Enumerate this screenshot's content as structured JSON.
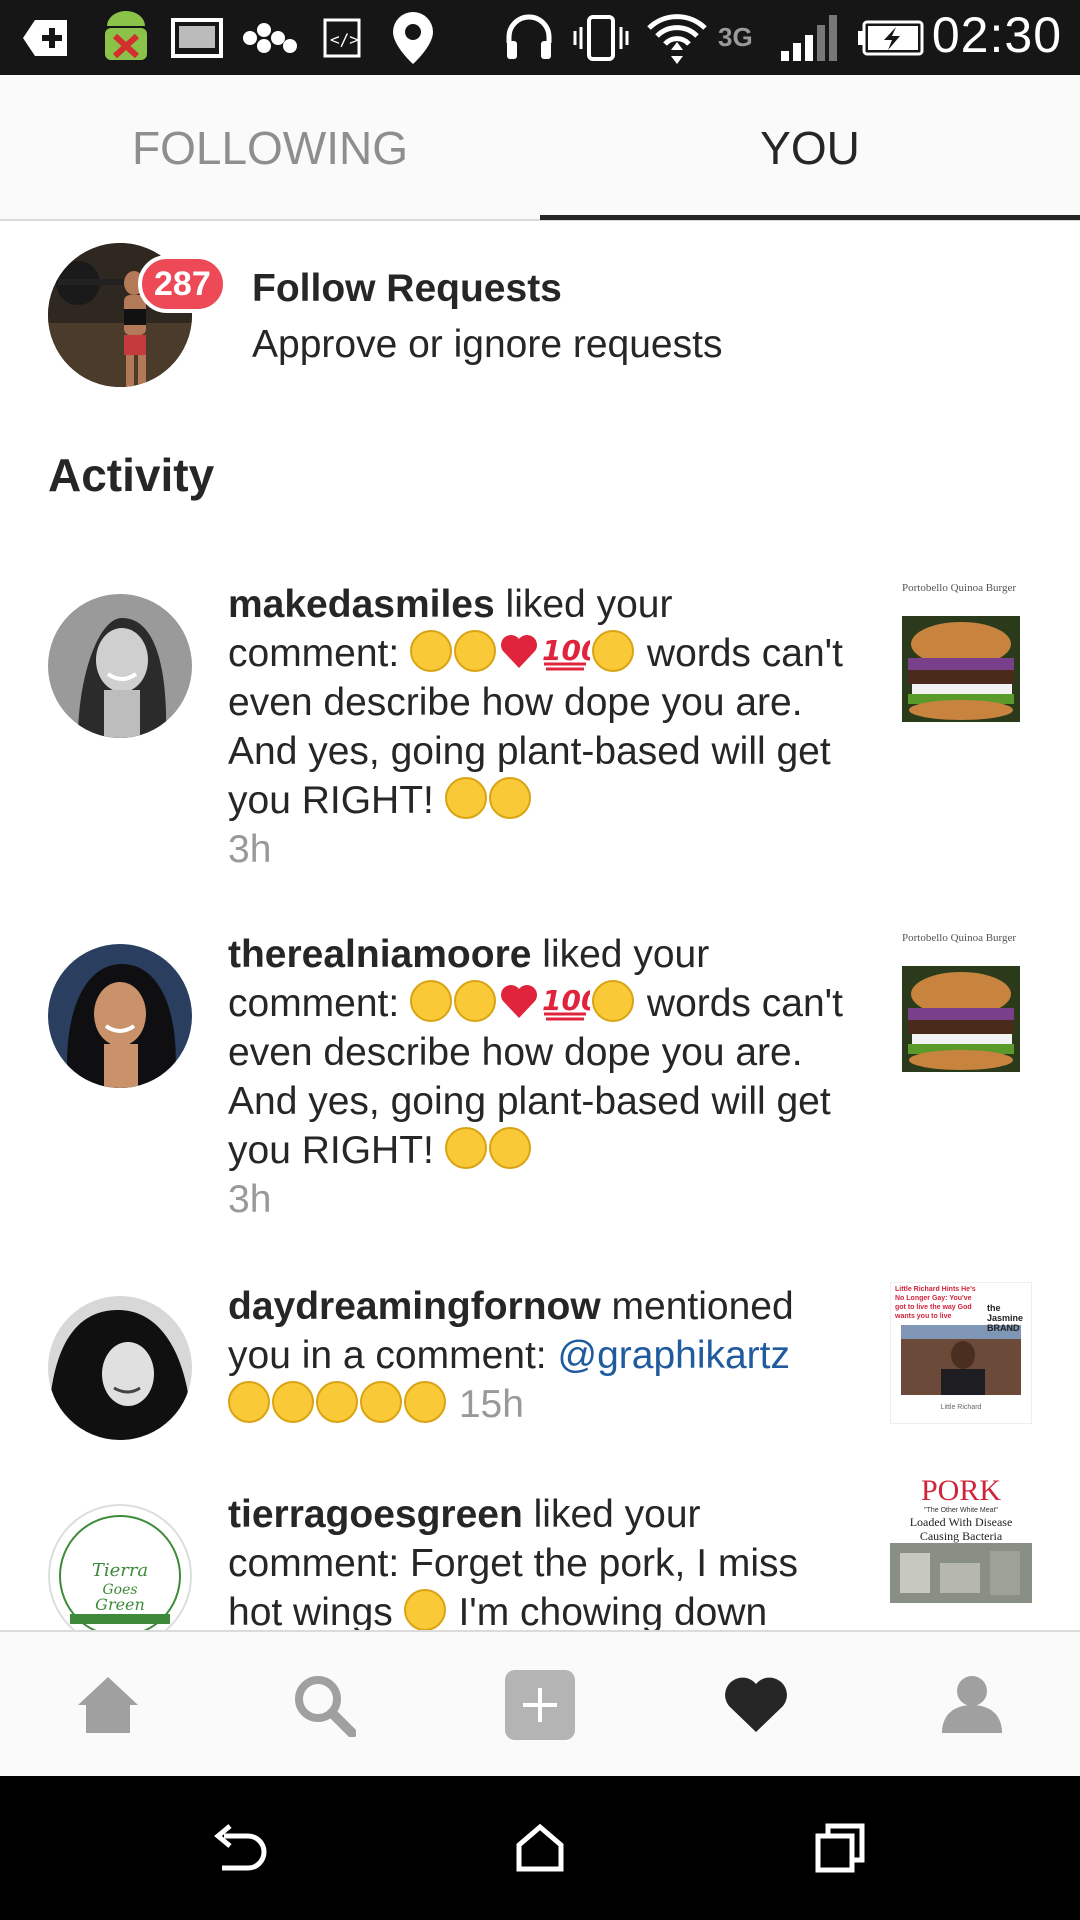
{
  "status_bar": {
    "time": "02:30",
    "network": "3G",
    "icons": [
      "add-icon",
      "android-icon",
      "image-icon",
      "dots-icon",
      "code-icon",
      "location-icon",
      "headset-icon",
      "vibrate-icon",
      "wifi-icon",
      "signal-icon",
      "battery-icon"
    ]
  },
  "tabs": {
    "following": "FOLLOWING",
    "you": "YOU",
    "selected": "you"
  },
  "follow_requests": {
    "badge": "287",
    "title": "Follow Requests",
    "subtitle": "Approve or ignore requests"
  },
  "activity": {
    "heading": "Activity",
    "items": [
      {
        "username": "makedasmiles",
        "action": " liked your comment: ",
        "text_after": " words can't even describe how dope you are. And yes, going plant-based will get you RIGHT! ",
        "time": "3h",
        "thumb_caption": "Portobello Quinoa Burger"
      },
      {
        "username": "therealniamoore",
        "action": " liked your comment: ",
        "text_after": " words can't even describe how dope you are. And yes, going plant-based will get you RIGHT! ",
        "time": "3h",
        "thumb_caption": "Portobello Quinoa Burger"
      },
      {
        "username": "daydreamingfornow",
        "action": " mentioned you in a comment: ",
        "mention": "@graphikartz",
        "time": "15h",
        "thumb_headline": "Little Richard Hints He's No Longer Gay: You've got to live the way God wants you to live",
        "thumb_brand": "the Jasmine BRAND",
        "thumb_footer": "Little Richard"
      },
      {
        "username": "tierragoesgreen",
        "action": " liked your comment: Forget the pork, I miss hot wings ",
        "text_after": " I'm chowing down",
        "thumb_headline": "PORK",
        "thumb_sub": "\"The Other White Meat\"",
        "thumb_sub2": "Loaded With Disease Causing Bacteria",
        "avatar_text": "Tierra Goes Green"
      }
    ]
  },
  "bottom_nav": [
    "home-icon",
    "search-icon",
    "add-post-icon",
    "activity-heart-icon",
    "profile-icon"
  ],
  "colors": {
    "badge": "#ed4956",
    "mention": "#1f5b9e",
    "time": "#999999"
  }
}
